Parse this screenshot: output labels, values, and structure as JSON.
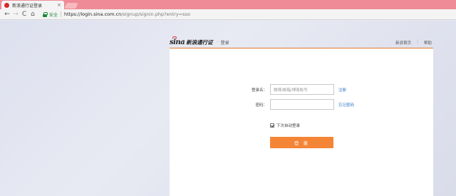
{
  "browser": {
    "tab_title": "新浪通行证登录",
    "tab_close": "×",
    "secure_label": "安全",
    "url_host": "https://login.sina.com.cn",
    "url_path": "/signup/signin.php?entry=sso",
    "back_icon": "←",
    "forward_icon": "→",
    "reload_icon": "C",
    "home_icon": "⌂"
  },
  "header": {
    "logo_text": "sina",
    "logo_sub": "新浪通行证",
    "divider": "·",
    "page_tag": "登录",
    "link_home": "新浪首页",
    "link_sep": "|",
    "link_help": "帮助"
  },
  "form": {
    "username_label": "登录名：",
    "username_placeholder": "微博/邮箱/博客帐号",
    "register_link": "注册",
    "password_label": "密码：",
    "password_value": "",
    "forgot_link": "忘记密码",
    "remember_label": "下次自动登录",
    "remember_checked": true,
    "login_button": "登 录"
  },
  "colors": {
    "accent": "#f58536",
    "tab_bar": "#ef8b96",
    "link": "#2b72c4",
    "header_line": "#e6772c",
    "brand_red": "#d42a2a"
  }
}
